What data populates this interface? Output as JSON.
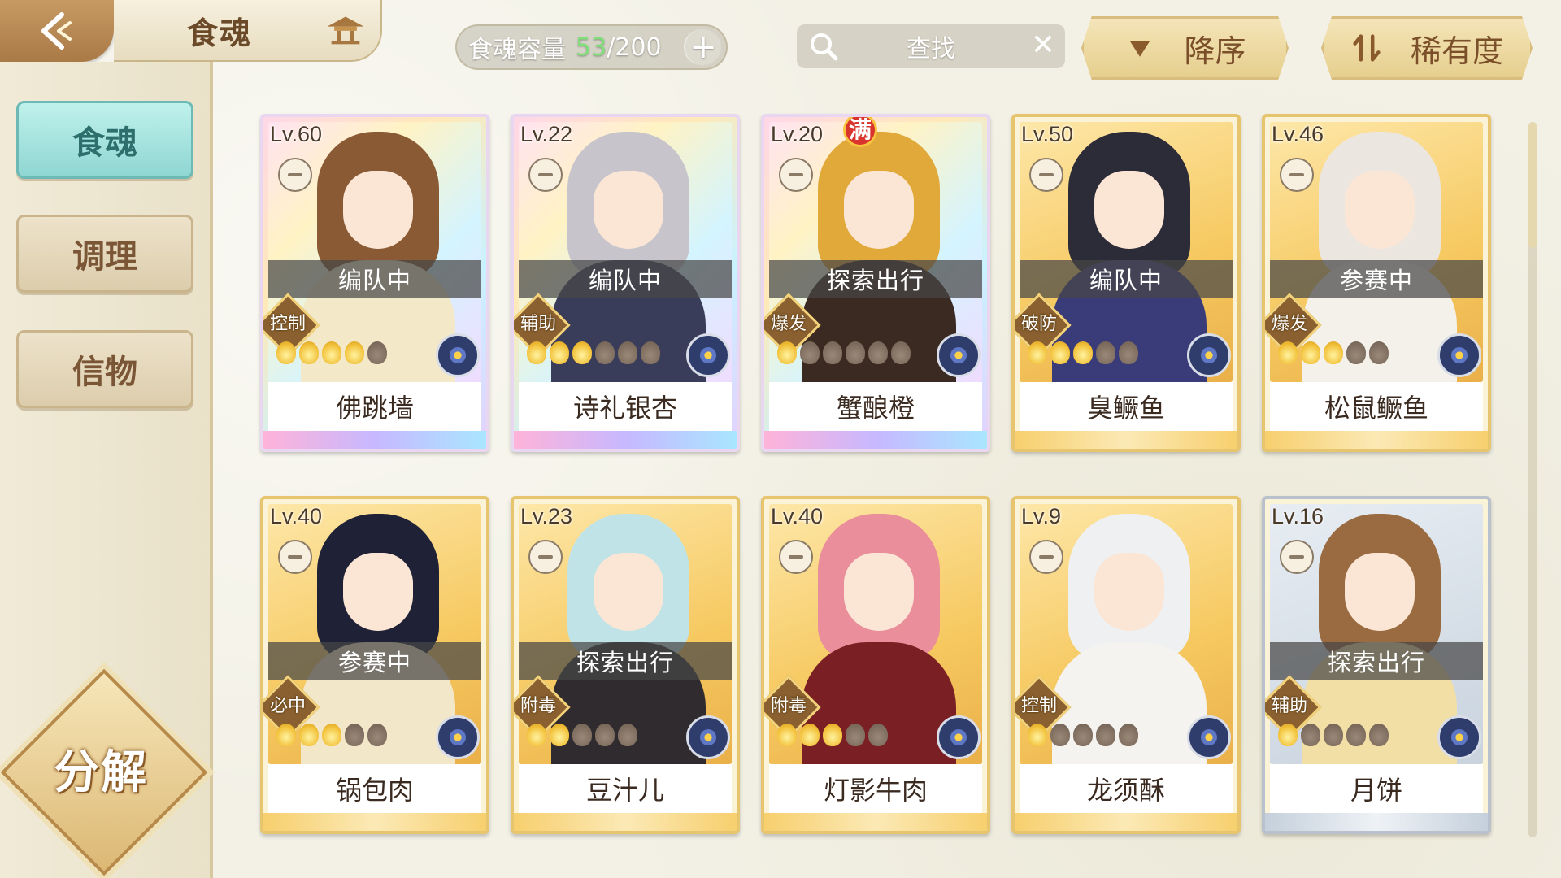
{
  "header": {
    "title": "食魂",
    "capacity_label": "食魂容量",
    "capacity_current": "53",
    "capacity_max": "/200",
    "add_symbol": "+",
    "search_placeholder": "查找",
    "clear_symbol": "✕",
    "sort_order_label": "降序",
    "sort_field_label": "稀有度"
  },
  "sidebar": {
    "items": [
      {
        "label": "食魂",
        "active": true
      },
      {
        "label": "调理",
        "active": false
      },
      {
        "label": "信物",
        "active": false
      }
    ],
    "decompose_label": "分解"
  },
  "colors": {
    "accent_teal": "#8fd6d2",
    "capacity_green": "#7fe07a",
    "gold_frame": "#e7c56e"
  },
  "cards": [
    {
      "level": "Lv.60",
      "status": "编队中",
      "role": "控制",
      "name": "佛跳墙",
      "stars": 5,
      "stars_lit": 4,
      "frame": "rainbow",
      "full": false
    },
    {
      "level": "Lv.22",
      "status": "编队中",
      "role": "辅助",
      "name": "诗礼银杏",
      "stars": 6,
      "stars_lit": 3,
      "frame": "rainbow",
      "full": false
    },
    {
      "level": "Lv.20",
      "status": "探索出行",
      "role": "爆发",
      "name": "蟹酿橙",
      "stars": 6,
      "stars_lit": 1,
      "frame": "rainbow",
      "full": true,
      "full_label": "满"
    },
    {
      "level": "Lv.50",
      "status": "编队中",
      "role": "破防",
      "name": "臭鳜鱼",
      "stars": 5,
      "stars_lit": 3,
      "frame": "gold",
      "full": false
    },
    {
      "level": "Lv.46",
      "status": "参赛中",
      "role": "爆发",
      "name": "松鼠鳜鱼",
      "stars": 5,
      "stars_lit": 3,
      "frame": "gold",
      "full": false
    },
    {
      "level": "Lv.40",
      "status": "参赛中",
      "role": "必中",
      "name": "锅包肉",
      "stars": 5,
      "stars_lit": 3,
      "frame": "gold",
      "full": false
    },
    {
      "level": "Lv.23",
      "status": "探索出行",
      "role": "附毒",
      "name": "豆汁儿",
      "stars": 5,
      "stars_lit": 2,
      "frame": "gold",
      "full": false
    },
    {
      "level": "Lv.40",
      "status": "",
      "role": "附毒",
      "name": "灯影牛肉",
      "stars": 5,
      "stars_lit": 3,
      "frame": "gold",
      "full": false
    },
    {
      "level": "Lv.9",
      "status": "",
      "role": "控制",
      "name": "龙须酥",
      "stars": 5,
      "stars_lit": 1,
      "frame": "gold",
      "full": false
    },
    {
      "level": "Lv.16",
      "status": "探索出行",
      "role": "辅助",
      "name": "月饼",
      "stars": 5,
      "stars_lit": 1,
      "frame": "silver",
      "full": false
    }
  ],
  "icons": {
    "back": "back-arrow-icon",
    "title": "pavilion-icon",
    "search": "search-icon",
    "sort_order": "triangle-down-icon",
    "sort_field": "swap-icon",
    "element": "element-flower-icon",
    "lock": "lock-icon"
  }
}
